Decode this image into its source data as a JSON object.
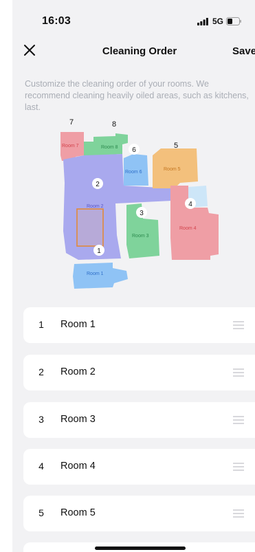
{
  "status_bar": {
    "time": "16:03",
    "network": "5G",
    "icons": [
      "signal-icon",
      "battery-icon"
    ]
  },
  "nav": {
    "title": "Cleaning Order",
    "save_label": "Save",
    "close_icon": "close-icon"
  },
  "description": "Customize the cleaning order of your rooms. We recommend cleaning heavily oiled areas, such as kitchens, last.",
  "map": {
    "rooms": [
      {
        "order": "1",
        "label": "Room 1",
        "color": "#8fc3f5"
      },
      {
        "order": "2",
        "label": "Room 2",
        "color": "#a9a9ee"
      },
      {
        "order": "3",
        "label": "Room 3",
        "color": "#7fd39b"
      },
      {
        "order": "4",
        "label": "Room 4",
        "color": "#ef9ea5"
      },
      {
        "order": "5",
        "label": "Room 5",
        "color": "#f3c07c"
      },
      {
        "order": "6",
        "label": "Room 6",
        "color": "#8fc3f5"
      },
      {
        "order": "7",
        "label": "Room 7",
        "color": "#ef9ea5"
      },
      {
        "order": "8",
        "label": "Room 8",
        "color": "#7fd39b"
      }
    ],
    "selection_color": "#e08a3c"
  },
  "order_list": [
    {
      "order": "1",
      "name": "Room 1"
    },
    {
      "order": "2",
      "name": "Room 2"
    },
    {
      "order": "3",
      "name": "Room 3"
    },
    {
      "order": "4",
      "name": "Room 4"
    },
    {
      "order": "5",
      "name": "Room 5"
    }
  ],
  "colors": {
    "background": "#f2f2f4",
    "card": "#ffffff",
    "muted_text": "#a9adb5",
    "handle": "#c8c8cc"
  }
}
